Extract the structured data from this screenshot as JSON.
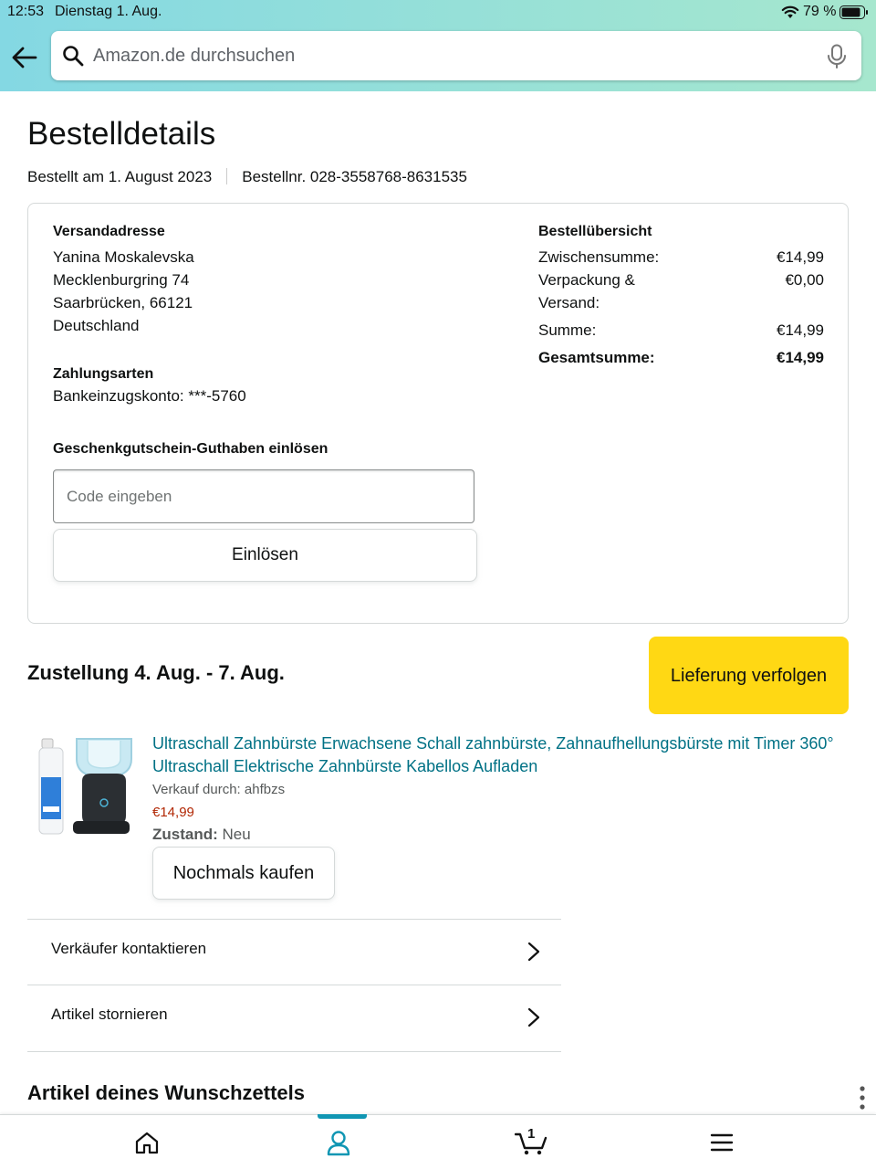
{
  "status_bar": {
    "time": "12:53",
    "date": "Dienstag 1. Aug.",
    "battery_pct": "79 %"
  },
  "search": {
    "placeholder": "Amazon.de durchsuchen"
  },
  "page": {
    "title": "Bestelldetails",
    "ordered_on": "Bestellt am 1. August 2023",
    "order_number": "Bestellnr. 028-3558768-8631535"
  },
  "shipping": {
    "heading": "Versandadresse",
    "lines": [
      "Yanina Moskalevska",
      "Mecklenburgring 74",
      "Saarbrücken, 66121",
      "Deutschland"
    ]
  },
  "payment": {
    "heading": "Zahlungsarten",
    "method": "Bankeinzugskonto: ***-5760"
  },
  "gift": {
    "heading": "Geschenkgutschein-Guthaben einlösen",
    "placeholder": "Code eingeben",
    "button": "Einlösen"
  },
  "summary": {
    "heading": "Bestellübersicht",
    "rows": [
      {
        "label": "Zwischensumme:",
        "value": "€14,99"
      },
      {
        "label": "Verpackung & Versand:",
        "value": "€0,00"
      },
      {
        "label": "Summe:",
        "value": "€14,99"
      },
      {
        "label": "Gesamtsumme:",
        "value": "€14,99"
      }
    ]
  },
  "delivery": {
    "heading": "Zustellung 4. Aug. - 7. Aug.",
    "track_button": "Lieferung verfolgen"
  },
  "product": {
    "title": "Ultraschall Zahnbürste Erwachsene Schall zahnbürste, Zahnaufhellungsbürste mit Timer 360° Ultraschall Elektrische Zahnbürste Kabellos Aufladen",
    "seller": "Verkauf durch: ahfbzs",
    "price": "€14,99",
    "condition_label": "Zustand:",
    "condition_value": "Neu",
    "buy_again": "Nochmals kaufen"
  },
  "actions": [
    {
      "label": "Verkäufer kontaktieren"
    },
    {
      "label": "Artikel stornieren"
    }
  ],
  "wishlist": {
    "heading": "Artikel deines Wunschzettels"
  },
  "navbar": {
    "cart_count": "1",
    "active_tab": "account"
  },
  "colors": {
    "accent": "#1096b3",
    "link": "#007185",
    "price": "#b12704",
    "track_button": "#ffd814"
  }
}
